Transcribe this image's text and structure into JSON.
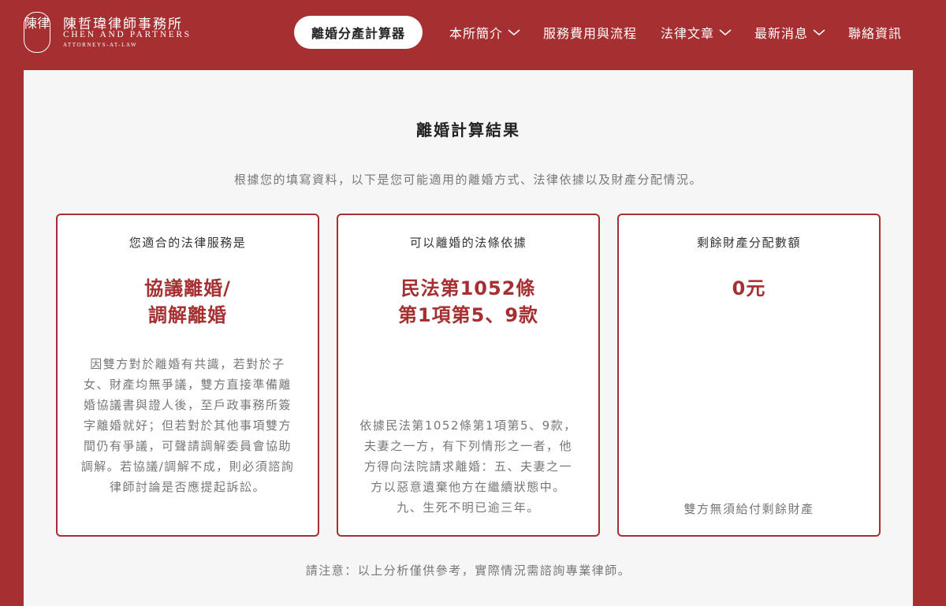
{
  "header": {
    "logo": {
      "seal_text": "陳律",
      "name_cn": "陳哲瑋律師事務所",
      "name_en": "CHEN AND PARTNERS",
      "subtitle": "ATTORNEYS-AT-LAW"
    },
    "cta_label": "離婚分產計算器",
    "nav": [
      {
        "label": "本所簡介",
        "dropdown": true
      },
      {
        "label": "服務費用與流程",
        "dropdown": false
      },
      {
        "label": "法律文章",
        "dropdown": true
      },
      {
        "label": "最新消息",
        "dropdown": true
      },
      {
        "label": "聯絡資訊",
        "dropdown": false
      }
    ]
  },
  "result": {
    "title": "離婚計算結果",
    "description": "根據您的填寫資料，以下是您可能適用的離婚方式、法律依據以及財產分配情況。",
    "cards": [
      {
        "heading": "您適合的法律服務是",
        "main_line1": "協議離婚/",
        "main_line2": "調解離婚",
        "body": "因雙方對於離婚有共識，若對於子女、財產均無爭議，雙方直接準備離婚協議書與證人後，至戶政事務所簽字離婚就好；但若對於其他事項雙方間仍有爭議，可聲請調解委員會協助調解。若協議/調解不成，則必須諮詢律師討論是否應提起訴訟。"
      },
      {
        "heading": "可以離婚的法條依據",
        "main_line1": "民法第1052條",
        "main_line2": "第1項第5、9款",
        "body": "依據民法第1052條第1項第5、9款，夫妻之一方，有下列情形之一者，他方得向法院請求離婚：五、夫妻之一方以惡意遺棄他方在繼續狀態中。九、生死不明已逾三年。"
      },
      {
        "heading": "剩餘財產分配數額",
        "main_line1": "0元",
        "main_line2": "",
        "body": "雙方無須給付剩餘財產"
      }
    ],
    "note": "請注意：以上分析僅供參考，實際情況需諮詢專業律師。"
  },
  "colors": {
    "brand": "#a52f31",
    "panel_bg": "#f6f6f6",
    "muted_text": "#777777"
  }
}
